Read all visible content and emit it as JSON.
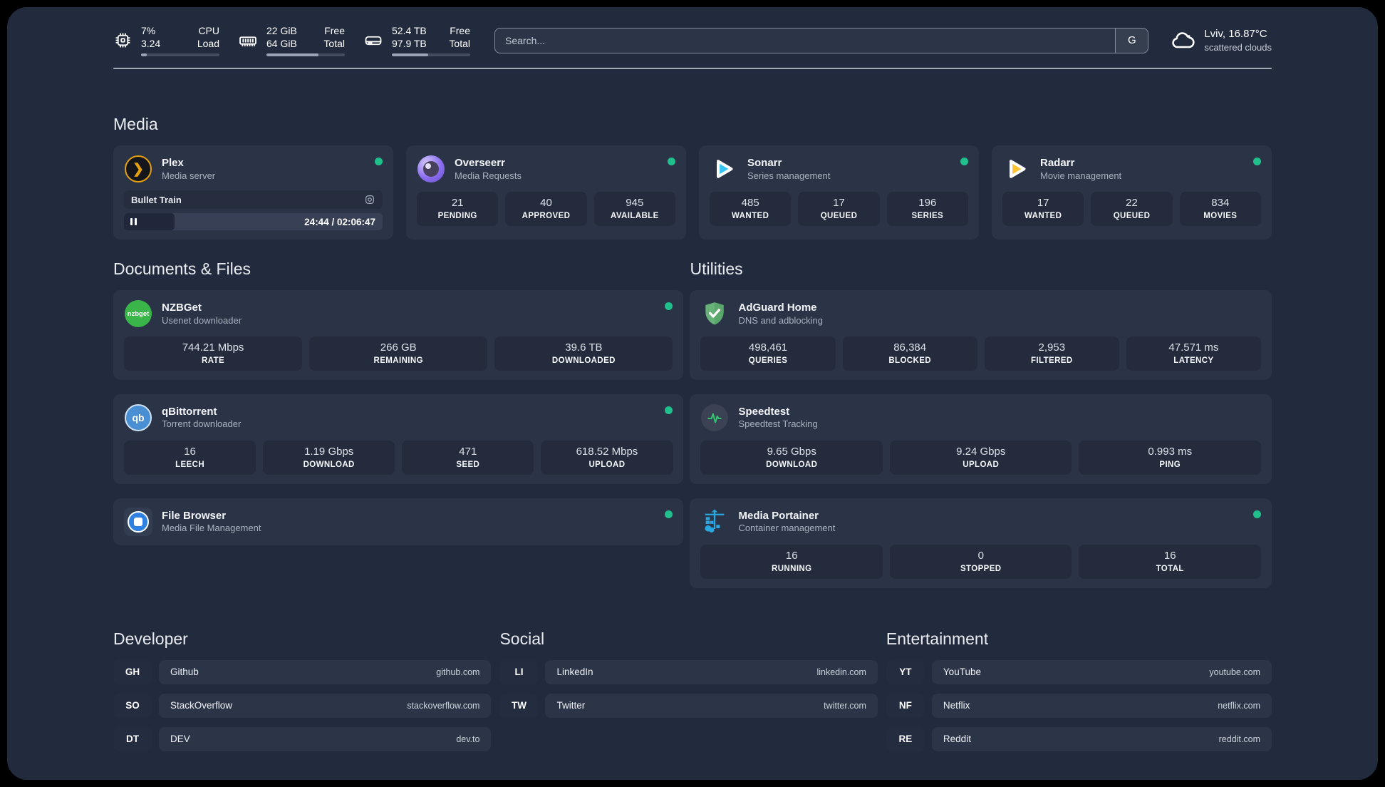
{
  "topbar": {
    "stats": [
      {
        "icon": "cpu-icon",
        "value_top": "7%",
        "value_bottom": "3.24",
        "label_top": "CPU",
        "label_bottom": "Load",
        "progress_pct": 7
      },
      {
        "icon": "ram-icon",
        "value_top": "22 GiB",
        "value_bottom": "64 GiB",
        "label_top": "Free",
        "label_bottom": "Total",
        "progress_pct": 66
      },
      {
        "icon": "disk-icon",
        "value_top": "52.4 TB",
        "value_bottom": "97.9 TB",
        "label_top": "Free",
        "label_bottom": "Total",
        "progress_pct": 46
      }
    ],
    "search": {
      "placeholder": "Search...",
      "engine_label": "G"
    },
    "weather": {
      "line1": "Lviv, 16.87°C",
      "line2": "scattered clouds"
    }
  },
  "sections": {
    "media": {
      "title": "Media",
      "cards": [
        {
          "name": "Plex",
          "subtitle": "Media server",
          "status": "online",
          "now_playing": {
            "title": "Bullet Train",
            "time": "24:44 / 02:06:47",
            "progress_pct": 19.5
          }
        },
        {
          "name": "Overseerr",
          "subtitle": "Media Requests",
          "status": "online",
          "stats": [
            {
              "value": "21",
              "label": "PENDING"
            },
            {
              "value": "40",
              "label": "APPROVED"
            },
            {
              "value": "945",
              "label": "AVAILABLE"
            }
          ]
        },
        {
          "name": "Sonarr",
          "subtitle": "Series management",
          "status": "online",
          "stats": [
            {
              "value": "485",
              "label": "WANTED"
            },
            {
              "value": "17",
              "label": "QUEUED"
            },
            {
              "value": "196",
              "label": "SERIES"
            }
          ]
        },
        {
          "name": "Radarr",
          "subtitle": "Movie management",
          "status": "online",
          "stats": [
            {
              "value": "17",
              "label": "WANTED"
            },
            {
              "value": "22",
              "label": "QUEUED"
            },
            {
              "value": "834",
              "label": "MOVIES"
            }
          ]
        }
      ]
    },
    "documents": {
      "title": "Documents & Files",
      "cards": [
        {
          "name": "NZBGet",
          "subtitle": "Usenet downloader",
          "status": "online",
          "stats": [
            {
              "value": "744.21 Mbps",
              "label": "RATE"
            },
            {
              "value": "266 GB",
              "label": "REMAINING"
            },
            {
              "value": "39.6 TB",
              "label": "DOWNLOADED"
            }
          ]
        },
        {
          "name": "qBittorrent",
          "subtitle": "Torrent downloader",
          "status": "online",
          "stats": [
            {
              "value": "16",
              "label": "LEECH"
            },
            {
              "value": "1.19 Gbps",
              "label": "DOWNLOAD"
            },
            {
              "value": "471",
              "label": "SEED"
            },
            {
              "value": "618.52 Mbps",
              "label": "UPLOAD"
            }
          ]
        },
        {
          "name": "File Browser",
          "subtitle": "Media File Management",
          "status": "online"
        }
      ]
    },
    "utilities": {
      "title": "Utilities",
      "cards": [
        {
          "name": "AdGuard Home",
          "subtitle": "DNS and adblocking",
          "stats": [
            {
              "value": "498,461",
              "label": "QUERIES"
            },
            {
              "value": "86,384",
              "label": "BLOCKED"
            },
            {
              "value": "2,953",
              "label": "FILTERED"
            },
            {
              "value": "47.571 ms",
              "label": "LATENCY"
            }
          ]
        },
        {
          "name": "Speedtest",
          "subtitle": "Speedtest Tracking",
          "stats": [
            {
              "value": "9.65 Gbps",
              "label": "DOWNLOAD"
            },
            {
              "value": "9.24 Gbps",
              "label": "UPLOAD"
            },
            {
              "value": "0.993 ms",
              "label": "PING"
            }
          ]
        },
        {
          "name": "Media Portainer",
          "subtitle": "Container management",
          "status": "online",
          "stats": [
            {
              "value": "16",
              "label": "RUNNING"
            },
            {
              "value": "0",
              "label": "STOPPED"
            },
            {
              "value": "16",
              "label": "TOTAL"
            }
          ]
        }
      ]
    },
    "developer": {
      "title": "Developer",
      "links": [
        {
          "prefix": "GH",
          "name": "Github",
          "url": "github.com"
        },
        {
          "prefix": "SO",
          "name": "StackOverflow",
          "url": "stackoverflow.com"
        },
        {
          "prefix": "DT",
          "name": "DEV",
          "url": "dev.to"
        }
      ]
    },
    "social": {
      "title": "Social",
      "links": [
        {
          "prefix": "LI",
          "name": "LinkedIn",
          "url": "linkedin.com"
        },
        {
          "prefix": "TW",
          "name": "Twitter",
          "url": "twitter.com"
        }
      ]
    },
    "entertainment": {
      "title": "Entertainment",
      "links": [
        {
          "prefix": "YT",
          "name": "YouTube",
          "url": "youtube.com"
        },
        {
          "prefix": "NF",
          "name": "Netflix",
          "url": "netflix.com"
        },
        {
          "prefix": "RE",
          "name": "Reddit",
          "url": "reddit.com"
        }
      ]
    }
  },
  "icon_labels": {
    "nzbget": "nzbget",
    "qbittorrent": "qb",
    "plex_chevron": "❯"
  },
  "colors": {
    "status_online": "#1fc08b",
    "portainer_blue": "#29a8e0",
    "plex_amber": "#e5a00d",
    "sonarr_blue": "#35c5f4",
    "radarr_amber": "#ffc230",
    "adguard_green": "#67b279"
  }
}
